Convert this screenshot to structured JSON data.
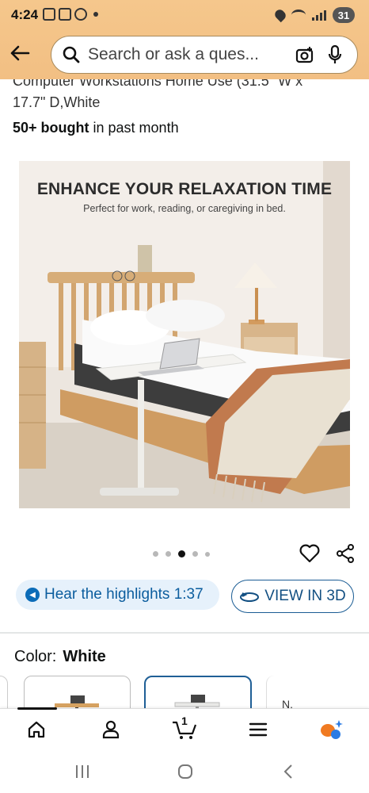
{
  "status_bar": {
    "time": "4:24",
    "battery": "31"
  },
  "search": {
    "placeholder": "Search or ask a ques..."
  },
  "product": {
    "title_partial_top": "Computer Workstations Home Use  (31.5\" W x",
    "title_line2": "17.7\" D,White",
    "bought_bold": "50+ bought",
    "bought_rest": " in past month",
    "image": {
      "headline": "ENHANCE YOUR RELAXATION TIME",
      "subline": "Perfect for work, reading, or caregiving in bed."
    },
    "image_pagination": {
      "total": 5,
      "active_index": 2
    }
  },
  "actions": {
    "hear_highlights": "Hear the highlights 1:37",
    "view_3d": "VIEW IN 3D"
  },
  "color": {
    "label": "Color:",
    "value": "White"
  },
  "swatches": {
    "cut_label": "N."
  },
  "bottom_nav": {
    "items": [
      {
        "icon": "home-icon"
      },
      {
        "icon": "account-icon"
      },
      {
        "icon": "cart-icon",
        "count": "1"
      },
      {
        "icon": "menu-icon"
      },
      {
        "icon": "rufus-ai-icon"
      }
    ]
  },
  "colors": {
    "header_bg": "#f3c385",
    "link_blue": "#0b5d9e",
    "selected_border": "#1f5f96"
  }
}
